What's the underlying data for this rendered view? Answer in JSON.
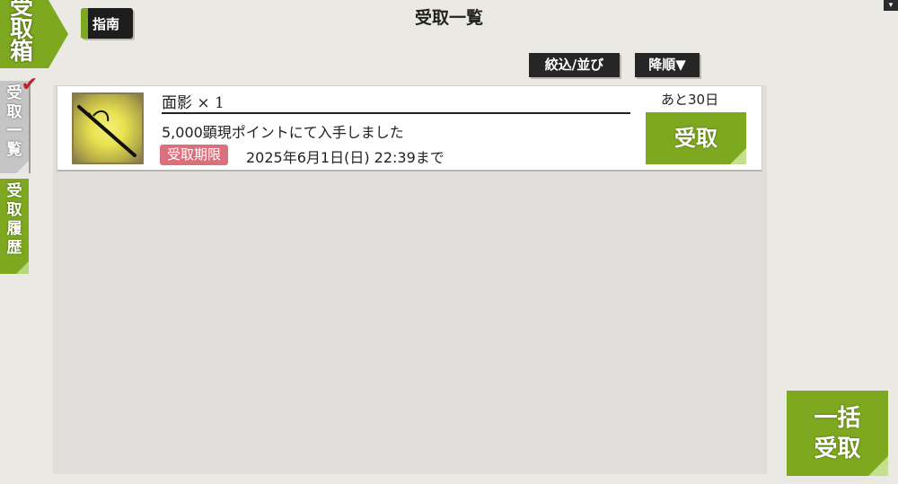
{
  "header": {
    "emblem_text": "受取箱",
    "guide_label": "指南",
    "title": "受取一覧"
  },
  "sidebar": {
    "tabs": [
      {
        "label": "受取一覧",
        "active": true
      },
      {
        "label": "受取履歴",
        "active": false
      }
    ]
  },
  "toolbar": {
    "filter_label": "絞込/並び",
    "sort_label": "降順▼"
  },
  "items": [
    {
      "name": "面影 × 1",
      "description": "5,000顕現ポイントにて入手しました",
      "deadline_badge": "受取期限",
      "deadline": "2025年6月1日(日) 22:39まで",
      "remaining": "あと30日",
      "receive_label": "受取",
      "icon": "sword-icon"
    }
  ],
  "bulk": {
    "line1": "一括",
    "line2": "受取"
  },
  "colors": {
    "accent_green": "#7ea81f",
    "badge_red": "#d9707b",
    "background": "#ebe9e4"
  }
}
